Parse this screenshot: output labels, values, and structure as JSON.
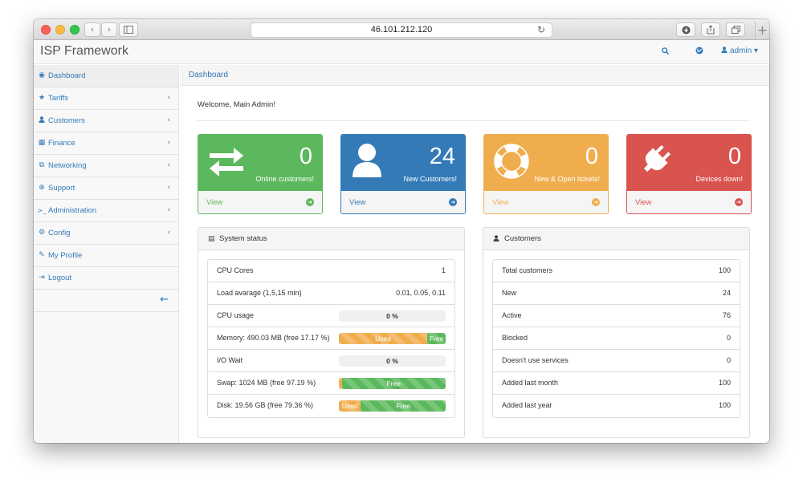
{
  "browser": {
    "url": "46.101.212.120",
    "back_icon": "chevron-left",
    "forward_icon": "chevron-right"
  },
  "navbar": {
    "brand": "ISP Framework",
    "user": "admin"
  },
  "sidebar": {
    "items": [
      {
        "label": "Dashboard",
        "icon": "dashboard-icon",
        "has_children": false
      },
      {
        "label": "Tariffs",
        "icon": "star-icon",
        "has_children": true
      },
      {
        "label": "Customers",
        "icon": "user-icon",
        "has_children": true
      },
      {
        "label": "Finance",
        "icon": "calculator-icon",
        "has_children": true
      },
      {
        "label": "Networking",
        "icon": "sitemap-icon",
        "has_children": true
      },
      {
        "label": "Support",
        "icon": "lifebuoy-icon",
        "has_children": true
      },
      {
        "label": "Administration",
        "icon": "terminal-icon",
        "has_children": true
      },
      {
        "label": "Config",
        "icon": "cogs-icon",
        "has_children": true
      },
      {
        "label": "My Profile",
        "icon": "pencil-icon",
        "has_children": false
      },
      {
        "label": "Logout",
        "icon": "sign-out-icon",
        "has_children": false
      }
    ]
  },
  "breadcrumb": "Dashboard",
  "welcome": "Welcome, Main Admin!",
  "stats": [
    {
      "value": "0",
      "label": "Online customers!",
      "link": "View",
      "color": "#5cb85c"
    },
    {
      "value": "24",
      "label": "New Customers!",
      "link": "View",
      "color": "#337ab7"
    },
    {
      "value": "0",
      "label": "New & Open tickets!",
      "link": "View",
      "color": "#f0ad4e"
    },
    {
      "value": "0",
      "label": "Devices down!",
      "link": "View",
      "color": "#d9534f"
    }
  ],
  "system_status": {
    "title": "System status",
    "rows": [
      {
        "label": "CPU Cores",
        "value": "1"
      },
      {
        "label": "Load avarage (1,5,15 min)",
        "value": "0.01, 0.05, 0.11"
      },
      {
        "label": "CPU usage",
        "bar_text": "0 %",
        "percent": 0
      },
      {
        "label": "Memory: 490.03 MB (free 17.17 %)",
        "used_label": "Used",
        "free_label": "Free",
        "free_percent": 17.17
      },
      {
        "label": "I/O Wait",
        "bar_text": "0 %",
        "percent": 0
      },
      {
        "label": "Swap: 1024 MB (free 97.19 %)",
        "free_label": "Free",
        "free_percent": 97.19
      },
      {
        "label": "Disk: 19.56 GB (free 79.36 %)",
        "used_label": "Used",
        "free_label": "Free",
        "free_percent": 79.36
      }
    ]
  },
  "customers": {
    "title": "Customers",
    "rows": [
      {
        "label": "Total customers",
        "value": "100"
      },
      {
        "label": "New",
        "value": "24"
      },
      {
        "label": "Active",
        "value": "76"
      },
      {
        "label": "Blocked",
        "value": "0"
      },
      {
        "label": "Doesn't use services",
        "value": "0"
      },
      {
        "label": "Added last month",
        "value": "100"
      },
      {
        "label": "Added last year",
        "value": "100"
      }
    ]
  }
}
